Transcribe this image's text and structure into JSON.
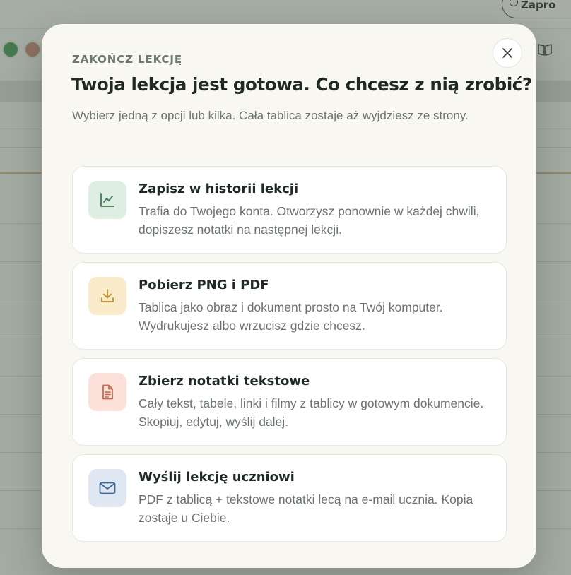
{
  "background": {
    "invite_button_label": "Zapro"
  },
  "modal": {
    "eyebrow": "ZAKOŃCZ LEKCJĘ",
    "title": "Twoja lekcja jest gotowa. Co chcesz z nią zrobić?",
    "subtitle": "Wybierz jedną z opcji lub kilka. Cała tablica zostaje aż wyjdziesz ze strony.",
    "close_icon": "close-icon",
    "options": [
      {
        "title": "Zapisz w historii lekcji",
        "description": "Trafia do Twojego konta. Otworzysz ponownie w każdej chwili, dopiszesz notatki na następnej lekcji.",
        "icon": "chart-line-icon",
        "icon_bg": "#dfeee2",
        "icon_color": "#3e7d52"
      },
      {
        "title": "Pobierz PNG i PDF",
        "description": "Tablica jako obraz i dokument prosto na Twój komputer. Wydrukujesz albo wrzucisz gdzie chcesz.",
        "icon": "download-icon",
        "icon_bg": "#faeccb",
        "icon_color": "#c08a2a"
      },
      {
        "title": "Zbierz notatki tekstowe",
        "description": "Cały tekst, tabele, linki i filmy z tablicy w gotowym dokumencie. Skopiuj, edytuj, wyślij dalej.",
        "icon": "document-icon",
        "icon_bg": "#fbe1d9",
        "icon_color": "#c8664a"
      },
      {
        "title": "Wyślij lekcję uczniowi",
        "description": "PDF z tablicą + tekstowe notatki lecą na e-mail ucznia. Kopia zostaje u Ciebie.",
        "icon": "mail-icon",
        "icon_bg": "#dfe8f2",
        "icon_color": "#3f6a96"
      }
    ]
  }
}
